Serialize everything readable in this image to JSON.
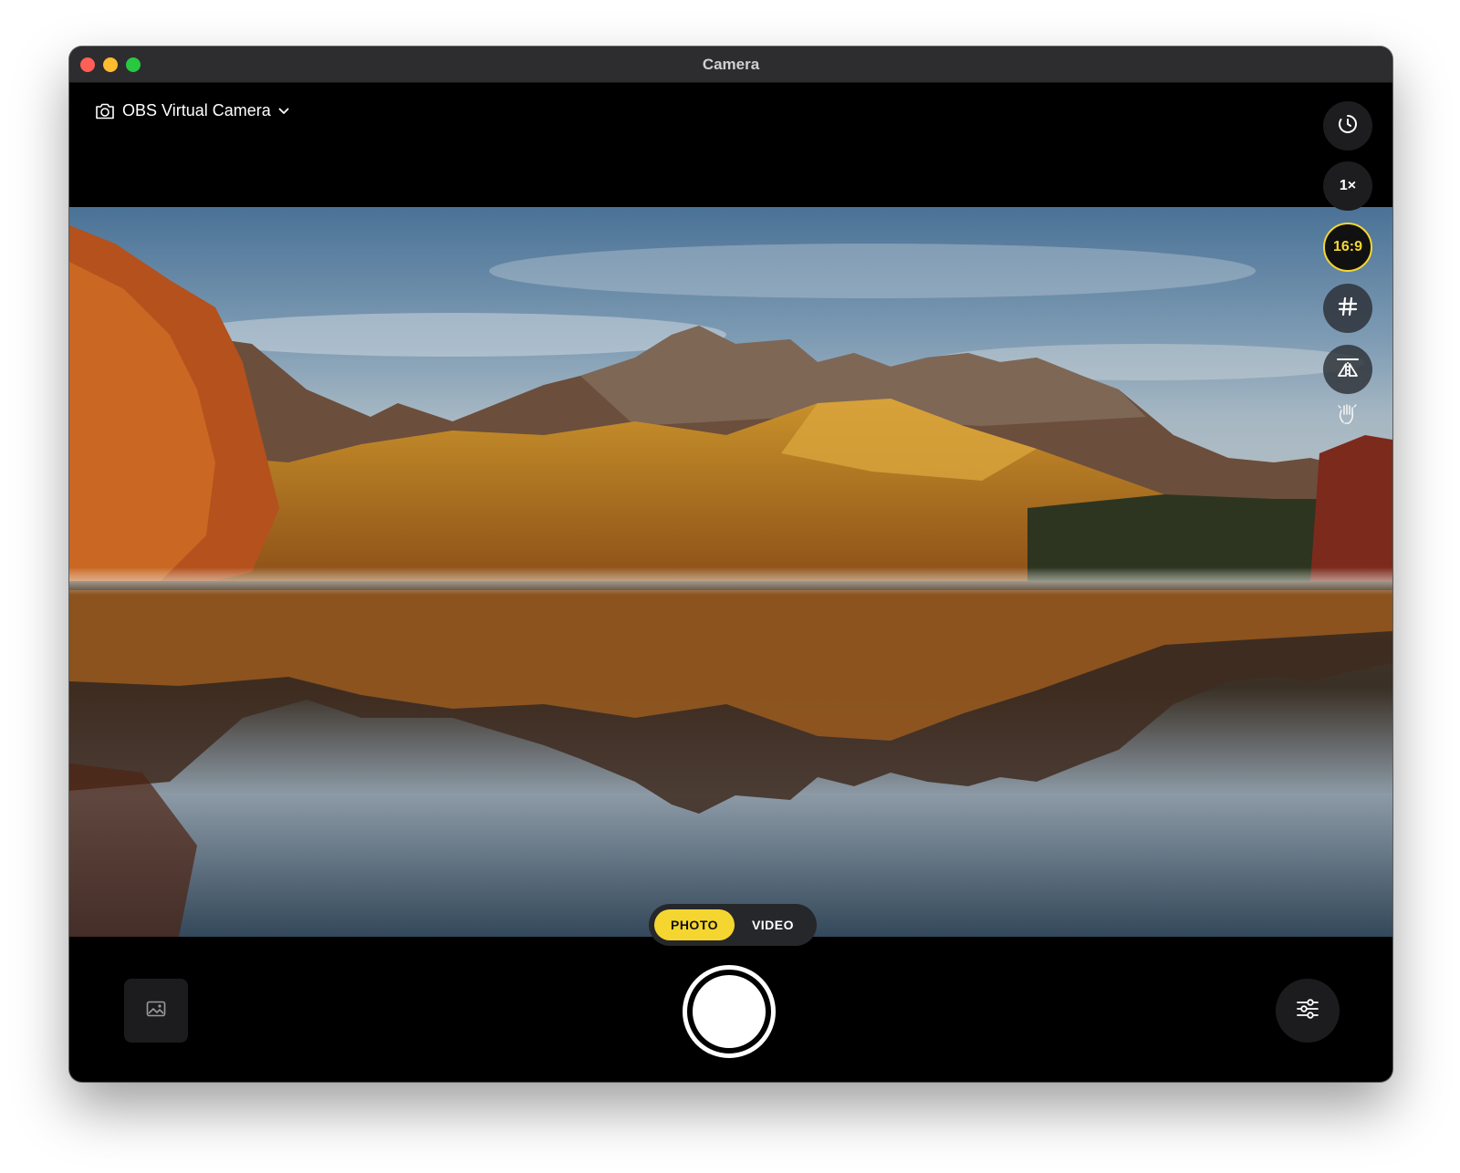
{
  "window": {
    "title": "Camera",
    "traffic_lights": [
      "close",
      "minimize",
      "zoom"
    ]
  },
  "source_picker": {
    "icon": "camera-icon",
    "label": "OBS Virtual Camera",
    "chevron": "chevron-down-icon"
  },
  "side_controls": [
    {
      "id": "timer",
      "icon": "timer-icon",
      "label": ""
    },
    {
      "id": "zoom",
      "icon": "",
      "label": "1×"
    },
    {
      "id": "aspect",
      "icon": "",
      "label": "16:9",
      "active": true,
      "accent": "#f5d630"
    },
    {
      "id": "grid",
      "icon": "grid-icon",
      "label": ""
    },
    {
      "id": "mirror",
      "icon": "mirror-icon",
      "label": ""
    },
    {
      "id": "gesture",
      "icon": "hand-gesture-icon",
      "label": ""
    }
  ],
  "modes": {
    "photo": "PHOTO",
    "video": "VIDEO",
    "selected": "PHOTO"
  },
  "bottom_bar": {
    "gallery_icon": "photo-library-icon",
    "shutter_icon": "shutter-button",
    "settings_icon": "sliders-icon"
  },
  "colors": {
    "accent": "#f5d630",
    "titlebar": "#2d2d2f",
    "background": "#000000"
  },
  "preview": {
    "scene": "autumn mountain reflected in lake"
  }
}
